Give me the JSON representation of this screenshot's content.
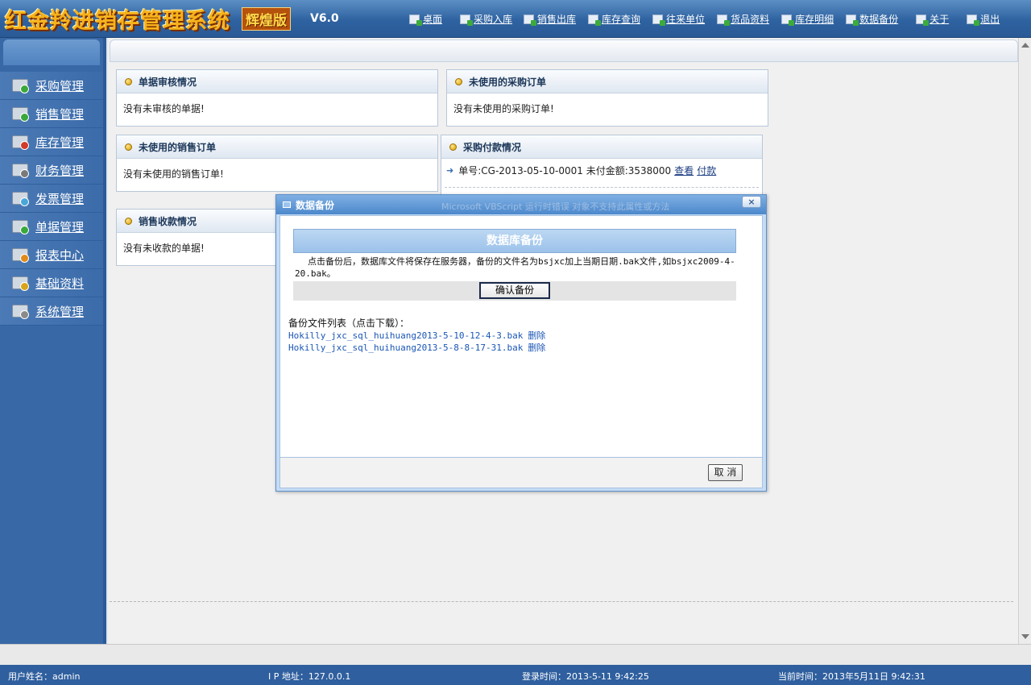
{
  "app": {
    "logo_text": "红金羚进销存管理系统",
    "edition": "辉煌版",
    "version": "V6.0"
  },
  "topnav": [
    {
      "label": "桌面",
      "icon": "desktop-icon"
    },
    {
      "label": "采购入库",
      "icon": "purchase-icon"
    },
    {
      "label": "销售出库",
      "icon": "sales-icon"
    },
    {
      "label": "库存查询",
      "icon": "inventory-query-icon"
    },
    {
      "label": "往来单位",
      "icon": "partners-icon"
    },
    {
      "label": "货品资料",
      "icon": "goods-icon"
    },
    {
      "label": "库存明细",
      "icon": "inventory-detail-icon"
    },
    {
      "label": "数据备份",
      "icon": "backup-icon"
    },
    {
      "label": "关于",
      "icon": "about-icon"
    },
    {
      "label": "退出",
      "icon": "logout-icon"
    }
  ],
  "sidebar": {
    "items": [
      {
        "label": "采购管理",
        "icon": "purchase-mgmt-icon",
        "badge_color": "#3aa83a"
      },
      {
        "label": "销售管理",
        "icon": "sales-cart-icon",
        "badge_color": "#3aa83a"
      },
      {
        "label": "库存管理",
        "icon": "stock-cart-icon",
        "badge_color": "#d23a2a"
      },
      {
        "label": "财务管理",
        "icon": "calculator-icon",
        "badge_color": "#7a7a7a"
      },
      {
        "label": "发票管理",
        "icon": "invoice-box-icon",
        "badge_color": "#4aa6d8"
      },
      {
        "label": "单据管理",
        "icon": "document-icon",
        "badge_color": "#3aa83a"
      },
      {
        "label": "报表中心",
        "icon": "report-truck-icon",
        "badge_color": "#e08a1a"
      },
      {
        "label": "基础资料",
        "icon": "base-data-icon",
        "badge_color": "#d8a41a"
      },
      {
        "label": "系统管理",
        "icon": "gear-icon",
        "badge_color": "#8a8a8a"
      }
    ]
  },
  "panels": {
    "audit": {
      "title": "单据审核情况",
      "text": "没有未审核的单据!"
    },
    "unused_purchase": {
      "title": "未使用的采购订单",
      "text": "没有未使用的采购订单!"
    },
    "unused_sales": {
      "title": "未使用的销售订单",
      "text": "没有未使用的销售订单!"
    },
    "purchase_payment": {
      "title": "采购付款情况",
      "line": "单号:CG-2013-05-10-0001 未付金额:3538000",
      "view_link": "查看",
      "pay_link": "付款"
    },
    "sales_receipt": {
      "title": "销售收款情况",
      "text": "没有未收款的单据!"
    }
  },
  "modal": {
    "title": "数据备份",
    "error_text": "Microsoft VBScript 运行时错误 对象不支持此属性或方法",
    "close_label": "×",
    "heading": "数据库备份",
    "description": "点击备份后，数据库文件将保存在服务器，备份的文件名为bsjxc加上当期日期.bak文件,如bsjxc2009-4-20.bak。",
    "confirm_label": "确认备份",
    "files_label": "备份文件列表（点击下载）：",
    "files": [
      {
        "name": "Hokilly_jxc_sql_huihuang2013-5-10-12-4-3.bak",
        "delete": "删除"
      },
      {
        "name": "Hokilly_jxc_sql_huihuang2013-5-8-8-17-31.bak",
        "delete": "删除"
      }
    ],
    "cancel_label": "取 消"
  },
  "status": {
    "user": "用户姓名：admin",
    "ip": "I P 地址：127.0.0.1",
    "login_time": "登录时间：2013-5-11 9:42:25",
    "current_time": "当前时间：2013年5月11日 9:42:31"
  }
}
